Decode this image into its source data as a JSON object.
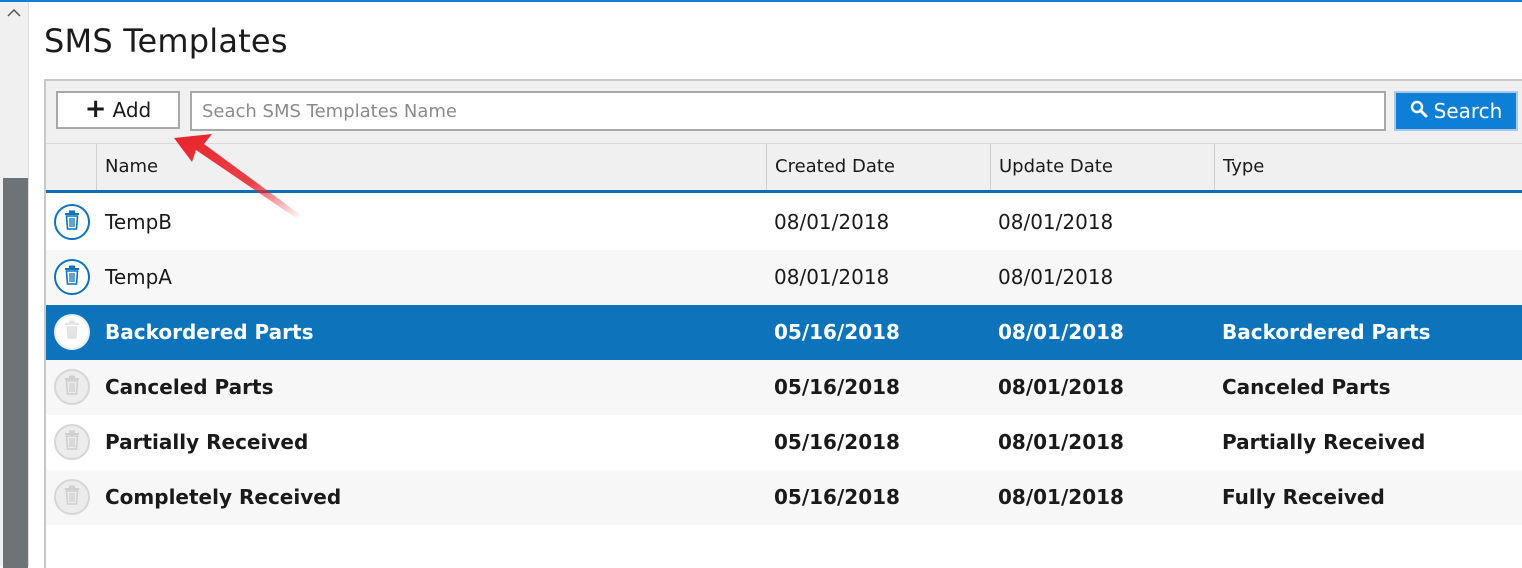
{
  "page": {
    "title": "SMS Templates"
  },
  "toolbar": {
    "add_label": "Add",
    "search_placeholder": "Seach SMS Templates Name",
    "search_label": "Search"
  },
  "columns": [
    "Name",
    "Created Date",
    "Update Date",
    "Type"
  ],
  "rows": [
    {
      "name": "TempB",
      "created": "08/01/2018",
      "updated": "08/01/2018",
      "type": ""
    },
    {
      "name": "TempA",
      "created": "08/01/2018",
      "updated": "08/01/2018",
      "type": ""
    },
    {
      "name": "Backordered Parts",
      "created": "05/16/2018",
      "updated": "08/01/2018",
      "type": "Backordered Parts"
    },
    {
      "name": "Canceled Parts",
      "created": "05/16/2018",
      "updated": "08/01/2018",
      "type": "Canceled Parts"
    },
    {
      "name": "Partially Received",
      "created": "05/16/2018",
      "updated": "08/01/2018",
      "type": "Partially Received"
    },
    {
      "name": "Completely Received",
      "created": "05/16/2018",
      "updated": "08/01/2018",
      "type": "Fully Received"
    }
  ],
  "selected_row": "Backordered Parts",
  "colors": {
    "accent": "#0e7fd6",
    "selected": "#0d73bb",
    "annotation_arrow": "#e8232a"
  },
  "icons": {
    "add": "plus-icon",
    "search": "search-icon",
    "delete": "trash-icon",
    "scroll_up": "chevron-up-icon"
  }
}
